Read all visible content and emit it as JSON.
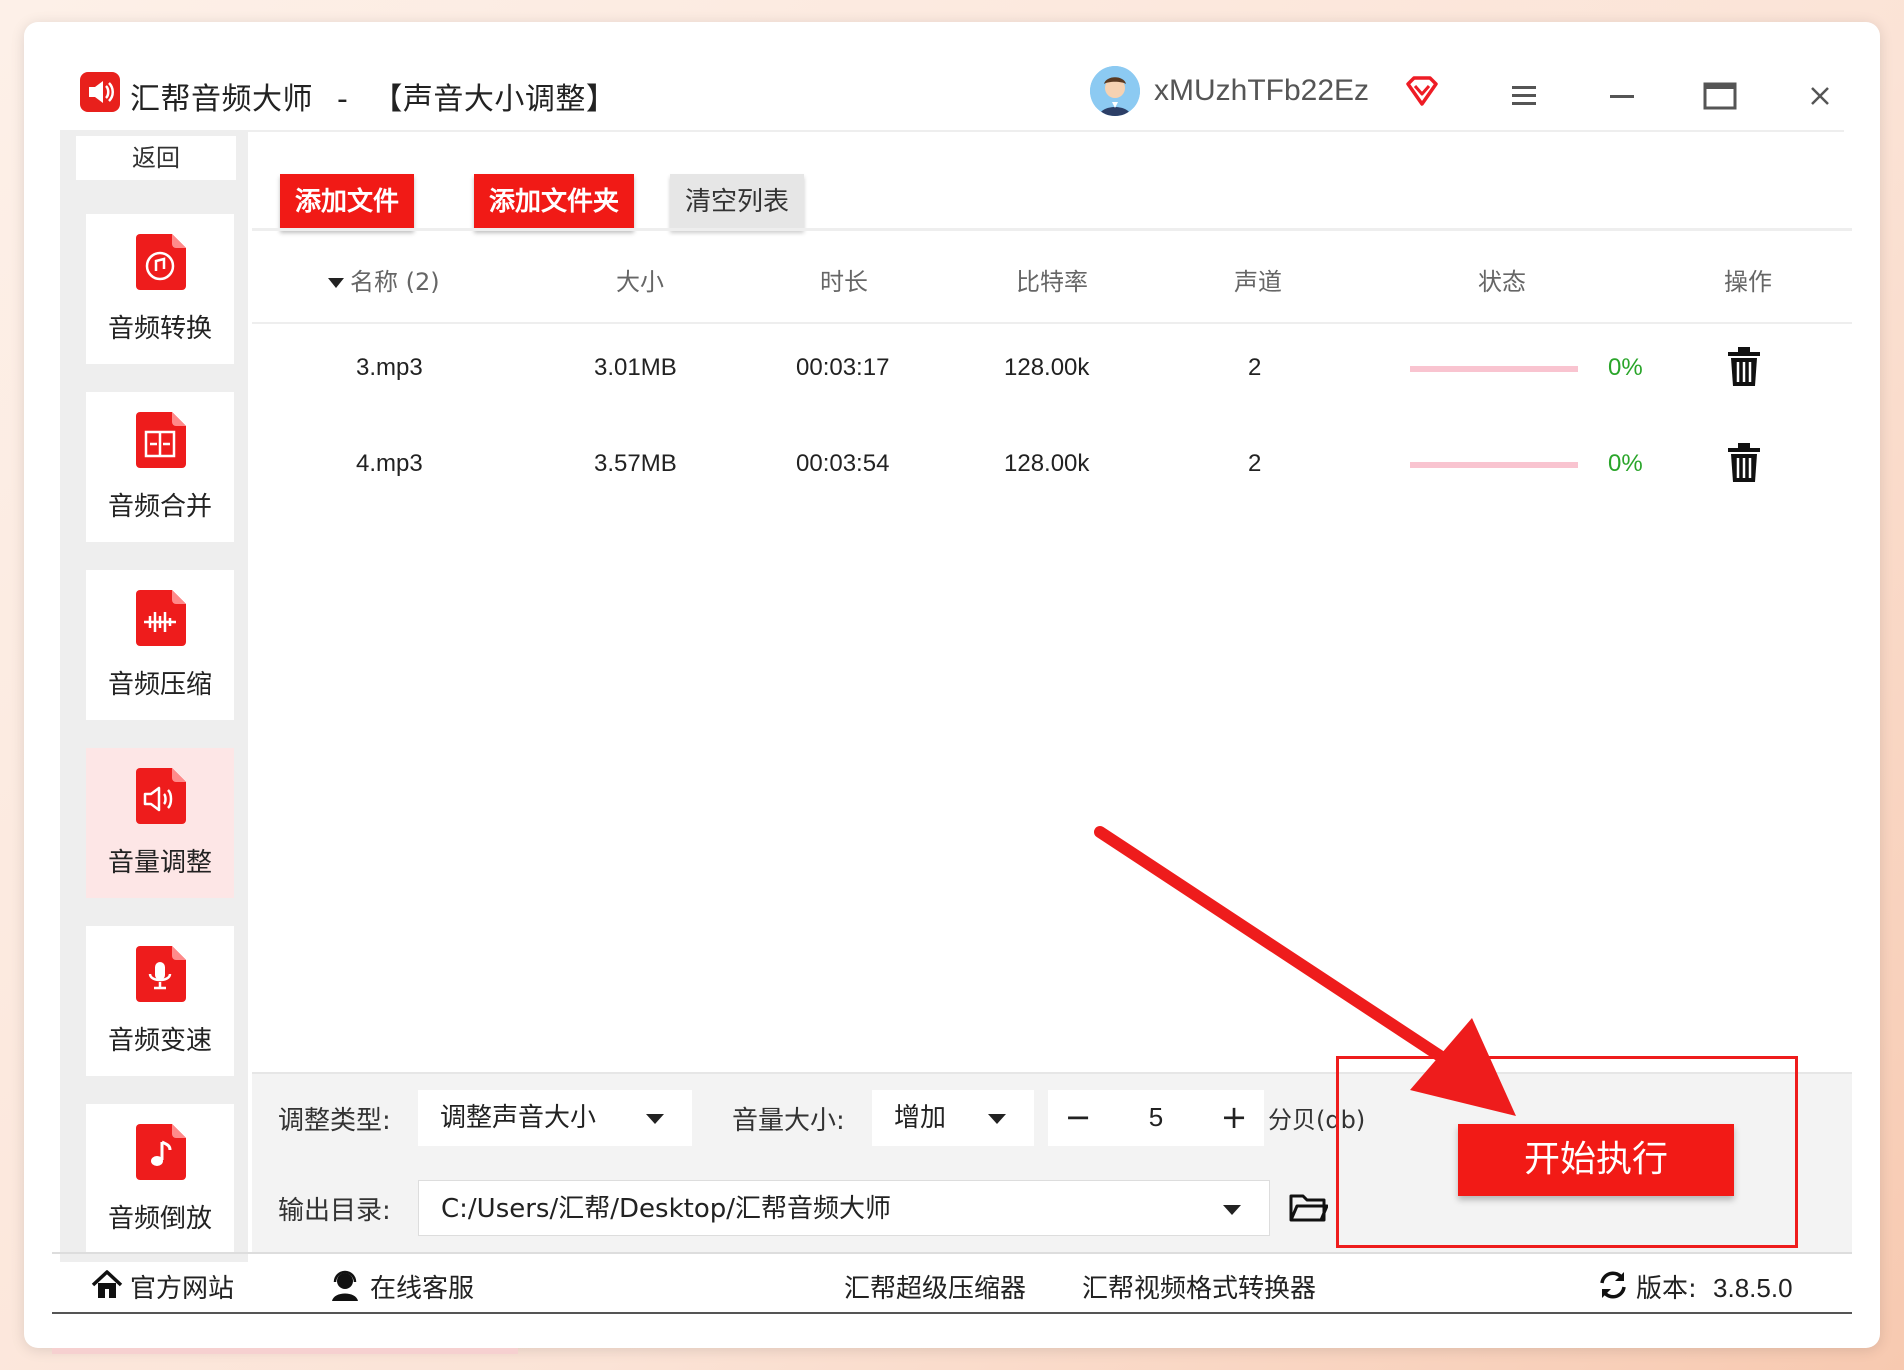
{
  "app": {
    "name": "汇帮音频大师",
    "separator": "-",
    "module": "【声音大小调整】",
    "user": "xMUzhTFb22Ez"
  },
  "sidebar": {
    "back_label": "返回",
    "items": [
      {
        "label": "音频转换",
        "icon": "audio-convert-icon"
      },
      {
        "label": "音频合并",
        "icon": "audio-merge-icon"
      },
      {
        "label": "音频压缩",
        "icon": "audio-compress-icon"
      },
      {
        "label": "音量调整",
        "icon": "volume-adjust-icon",
        "active": true
      },
      {
        "label": "音频变速",
        "icon": "audio-speed-icon"
      },
      {
        "label": "音频倒放",
        "icon": "audio-reverse-icon"
      }
    ]
  },
  "toolbar": {
    "add_file": "添加文件",
    "add_folder": "添加文件夹",
    "clear_list": "清空列表"
  },
  "table": {
    "headers": {
      "name": "名称 (2)",
      "size": "大小",
      "duration": "时长",
      "bitrate": "比特率",
      "channels": "声道",
      "status": "状态",
      "action": "操作"
    },
    "rows": [
      {
        "name": "3.mp3",
        "size": "3.01MB",
        "duration": "00:03:17",
        "bitrate": "128.00k",
        "channels": "2",
        "progress": "0%"
      },
      {
        "name": "4.mp3",
        "size": "3.57MB",
        "duration": "00:03:54",
        "bitrate": "128.00k",
        "channels": "2",
        "progress": "0%"
      }
    ]
  },
  "settings": {
    "type_label": "调整类型:",
    "type_value": "调整声音大小",
    "volume_label": "音量大小:",
    "volume_mode": "增加",
    "minus": "−",
    "volume_value": "5",
    "plus": "+",
    "unit": "分贝(db)",
    "output_label": "输出目录:",
    "output_path": "C:/Users/汇帮/Desktop/汇帮音频大师"
  },
  "start_button": "开始执行",
  "footer": {
    "website": "官方网站",
    "support": "在线客服",
    "compressor": "汇帮超级压缩器",
    "video_converter": "汇帮视频格式转换器",
    "version_label": "版本:",
    "version": "3.8.5.0"
  },
  "colors": {
    "brand_red": "#f11a16",
    "success_green": "#2aa52a",
    "progress_track": "#f9c4d0",
    "sidebar_active": "#fde6e6"
  }
}
